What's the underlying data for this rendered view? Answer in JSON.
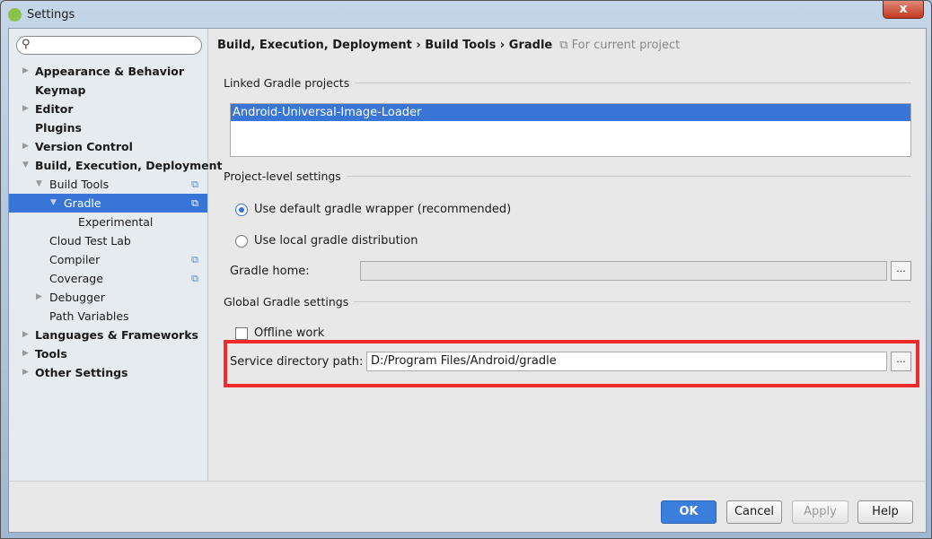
{
  "window": {
    "title": "Settings",
    "close_label": "x"
  },
  "search": {
    "placeholder": ""
  },
  "sidebar": {
    "items": [
      {
        "label": "Appearance & Behavior"
      },
      {
        "label": "Keymap"
      },
      {
        "label": "Editor"
      },
      {
        "label": "Plugins"
      },
      {
        "label": "Version Control"
      },
      {
        "label": "Build, Execution, Deployment"
      },
      {
        "label": "Build Tools"
      },
      {
        "label": "Gradle"
      },
      {
        "label": "Experimental"
      },
      {
        "label": "Cloud Test Lab"
      },
      {
        "label": "Compiler"
      },
      {
        "label": "Coverage"
      },
      {
        "label": "Debugger"
      },
      {
        "label": "Path Variables"
      },
      {
        "label": "Languages & Frameworks"
      },
      {
        "label": "Tools"
      },
      {
        "label": "Other Settings"
      }
    ]
  },
  "breadcrumb": {
    "part1": "Build, Execution, Deployment",
    "part2": "Build Tools",
    "part3": "Gradle",
    "scope": "For current project",
    "sep": "›"
  },
  "linked": {
    "title": "Linked Gradle projects",
    "projects": [
      "Android-Universal-Image-Loader"
    ]
  },
  "project": {
    "title": "Project-level settings",
    "option_default": "Use default gradle wrapper (recommended)",
    "option_local": "Use local gradle distribution",
    "selected": "default",
    "gradle_home_label": "Gradle home:",
    "gradle_home_value": ""
  },
  "global": {
    "title": "Global Gradle settings",
    "offline_label": "Offline work",
    "offline_checked": false,
    "service_label": "Service directory path:",
    "service_value": "D:/Program Files/Android/gradle",
    "browse": "..."
  },
  "buttons": {
    "ok": "OK",
    "cancel": "Cancel",
    "apply": "Apply",
    "help": "Help"
  },
  "colors": {
    "accent": "#3875d7",
    "highlight_box": "#ee2b2b"
  }
}
